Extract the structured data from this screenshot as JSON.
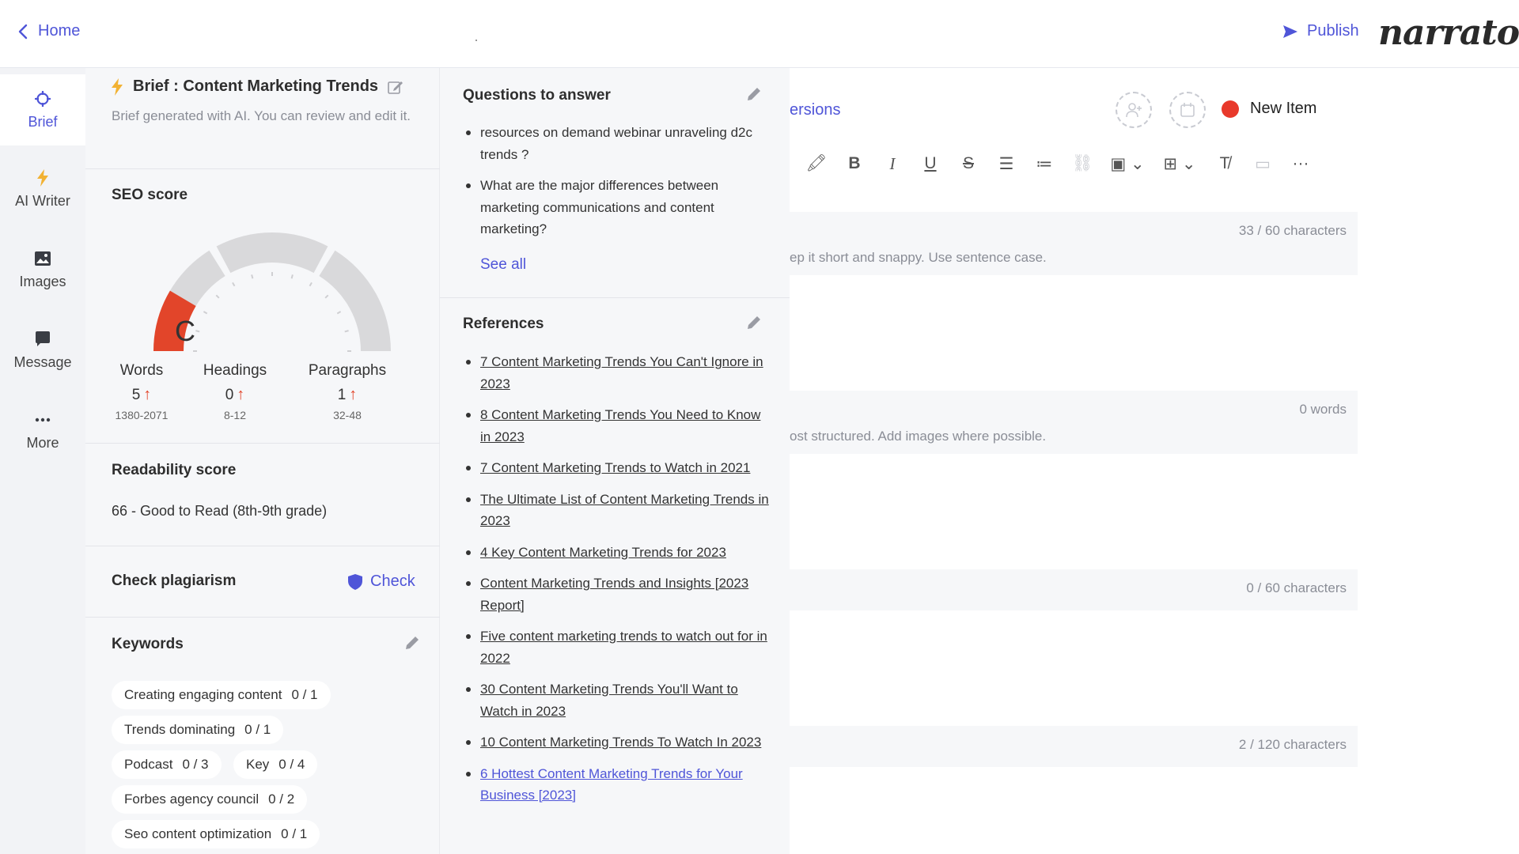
{
  "topbar": {
    "home_label": "Home",
    "publish_label": "Publish",
    "logo_text": "narrato"
  },
  "rail": {
    "items": [
      {
        "label": "Brief",
        "icon": "crosshair-icon"
      },
      {
        "label": "AI Writer",
        "icon": "lightning-icon"
      },
      {
        "label": "Images",
        "icon": "image-icon"
      },
      {
        "label": "Message",
        "icon": "chat-icon"
      },
      {
        "label": "More",
        "icon": "more-dots-icon"
      }
    ]
  },
  "brief": {
    "title": "Brief : Content Marketing Trends",
    "subtitle": "Brief generated with AI. You can review and edit it.",
    "seo": {
      "heading": "SEO score",
      "grade": "C",
      "score_fraction": 0.17,
      "stats": [
        {
          "label": "Words",
          "value": "5",
          "range": "1380-2071"
        },
        {
          "label": "Headings",
          "value": "0",
          "range": "8-12"
        },
        {
          "label": "Paragraphs",
          "value": "1",
          "range": "32-48"
        }
      ]
    },
    "readability": {
      "heading": "Readability score",
      "value": "66 - Good to Read (8th-9th grade)"
    },
    "plagiarism": {
      "heading": "Check plagiarism",
      "button": "Check"
    },
    "keywords": {
      "heading": "Keywords",
      "items": [
        {
          "text": "Creating engaging content",
          "count": "0 / 1"
        },
        {
          "text": "Trends dominating",
          "count": "0 / 1"
        },
        {
          "text": "Podcast",
          "count": "0 / 3"
        },
        {
          "text": "Key",
          "count": "0 / 4"
        },
        {
          "text": "Forbes agency council",
          "count": "0 / 2"
        },
        {
          "text": "Seo content optimization",
          "count": "0 / 1"
        }
      ]
    }
  },
  "questions": {
    "heading": "Questions to answer",
    "items": [
      "resources on demand webinar unraveling d2c trends ?",
      "What are the major differences between marketing communications and content marketing?"
    ],
    "see_all": "See all"
  },
  "references": {
    "heading": "References",
    "items": [
      "7 Content Marketing Trends You Can't Ignore in 2023",
      "8 Content Marketing Trends You Need to Know in 2023",
      "7 Content Marketing Trends to Watch in 2021",
      "The Ultimate List of Content Marketing Trends in 2023",
      "4 Key Content Marketing Trends for 2023",
      "Content Marketing Trends and Insights [2023 Report]",
      "Five content marketing trends to watch out for in 2022",
      "30 Content Marketing Trends You'll Want to Watch in 2023",
      "10 Content Marketing Trends To Watch In 2023",
      "6 Hottest Content Marketing Trends for Your Business [2023]"
    ]
  },
  "editor": {
    "versions_label": "ersions",
    "status_label": "New Item",
    "status_color": "#e8392b",
    "fields": [
      {
        "count": "33 / 60 characters",
        "hint": "ep it short and snappy. Use sentence case."
      },
      {
        "count": "0 words",
        "hint": "ost structured. Add images where possible."
      },
      {
        "count": "0 / 60 characters",
        "hint": ""
      },
      {
        "count": "2 / 120 characters",
        "hint": ""
      }
    ]
  },
  "colors": {
    "accent": "#4f55d8",
    "gauge_red": "#e2452a",
    "status_red": "#e8392b"
  }
}
